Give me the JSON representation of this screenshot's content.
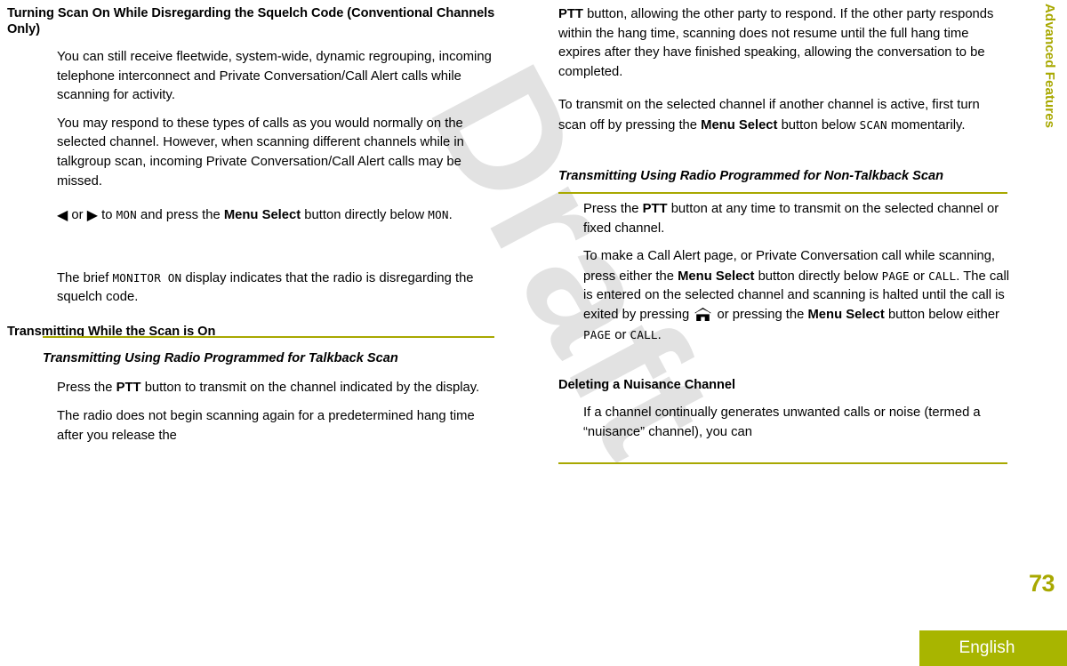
{
  "document": {
    "watermark": "Draft",
    "side_tab_label": "Advanced Features",
    "page_number": "73",
    "language": "English",
    "accent_color": "#a8a800",
    "language_bar_color": "#a8b500",
    "watermark_color": "#e2e2e2"
  },
  "left_column": {
    "heading": "Turning Scan On While Disregarding the Squelch Code (Conventional Channels Only)",
    "para_1": "You can still receive fleetwide, system-wide, dynamic regrouping, incoming telephone interconnect and Private Conversation/Call Alert calls while scanning for activity.",
    "para_2": "You may respond to these types of calls as you would normally on the selected channel. However, when scanning different channels while in talkgroup scan, incoming Private Conversation/Call Alert calls may be missed.",
    "step": {
      "arrow_left": "◀",
      "arrow_right": "▶",
      "text_or": " or ",
      "text_to": " to ",
      "lcd_1": "MON",
      "text_mid": " and press the ",
      "bold_1": "Menu Select",
      "text_after": " button directly below ",
      "lcd_2": "MON",
      "text_end": "."
    },
    "para_3": {
      "pre": "The brief ",
      "lcd": "MONITOR ON",
      "post": " display indicates that the radio is disregarding the squelch code."
    },
    "heading_2": "Transmitting While the Scan is On",
    "subheading_1": "Transmitting Using Radio Programmed for Talkback Scan",
    "para_4": {
      "pre": "Press the ",
      "bold": "PTT",
      "post": " button to transmit on the channel indicated by the display."
    },
    "para_5": "The radio does not begin scanning again for a predetermined hang time after you release the"
  },
  "right_column": {
    "para_1": {
      "bold": "PTT",
      "post": " button, allowing the other party to respond. If the other party responds within the hang time, scanning does not resume until the full hang time expires after they have finished speaking, allowing the conversation to be completed."
    },
    "para_2": {
      "pre": "To transmit on the selected channel if another channel is active, first turn scan off by pressing the ",
      "bold": "Menu Select",
      "mid": " button below ",
      "lcd": "SCAN",
      "post": " momentarily."
    },
    "subheading_1": "Transmitting Using Radio Programmed for Non-Talkback Scan",
    "para_3": {
      "pre": "Press the ",
      "bold": "PTT",
      "post": " button at any time to transmit on the selected channel or fixed channel."
    },
    "para_4": {
      "pre": "To make a Call Alert page, or Private Conversation call while scanning, press either the ",
      "bold_1": "Menu Select",
      "mid_1": " button directly below ",
      "lcd_1": "PAGE",
      "mid_2": " or ",
      "lcd_2": "CALL",
      "mid_3": ". The call is entered on the selected channel and scanning is halted until the call is exited by pressing ",
      "icon": "home-icon",
      "mid_4": " or pressing the ",
      "bold_2": "Menu Select",
      "mid_5": " button below either ",
      "lcd_3": "PAGE",
      "mid_6": " or ",
      "lcd_4": "CALL",
      "post": "."
    },
    "heading_1": "Deleting a Nuisance Channel",
    "para_5": "If a channel continually generates unwanted calls or noise (termed a “nuisance” channel), you can"
  }
}
